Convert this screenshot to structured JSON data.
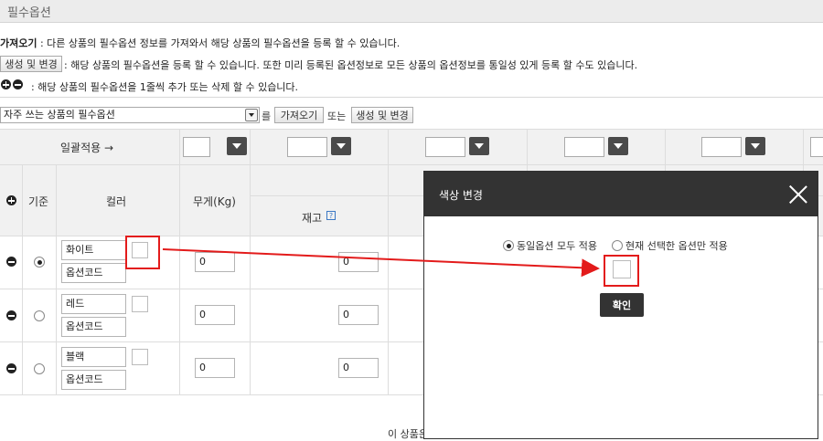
{
  "page": {
    "title": "필수옵션"
  },
  "intro": {
    "import_label": "가져오기",
    "import_desc": " : 다른 상품의 필수옵션 정보를 가져와서 해당 상품의 필수옵션을 등록 할 수 있습니다.",
    "generate_button": "생성 및 변경",
    "generate_desc": " : 해당 상품의 필수옵션을 등록 할 수 있습니다. 또한 미리 등록된 옵션정보로 모든 상품의 옵션정보를 통일성 있게 등록 할 수도 있습니다.",
    "addremove_desc": ": 해당 상품의 필수옵션을 1줄씩 추가 또는 삭제 할 수 있습니다."
  },
  "toolbar": {
    "preset_select": "자주 쓰는 상품의 필수옵션",
    "particle": "를",
    "import_button": "가져오기",
    "or": "또는",
    "generate_button": "생성 및 변경"
  },
  "table": {
    "bulk_apply": "일괄적용 →",
    "col_default": "기준",
    "col_color": "컬러",
    "col_weight": "무게(Kg)",
    "col_stock": "재고",
    "option_code_placeholder": "옵션코드",
    "rows": [
      {
        "color": "화이트",
        "code": "옵션코드",
        "weight": "0",
        "stock": "0",
        "selected": true
      },
      {
        "color": "레드",
        "code": "옵션코드",
        "weight": "0",
        "stock": "0",
        "selected": false
      },
      {
        "color": "블랙",
        "code": "옵션코드",
        "weight": "0",
        "stock": "0",
        "selected": false
      }
    ],
    "footer_fragment": "이 상품은"
  },
  "modal": {
    "title": "색상 변경",
    "option_all": "동일옵션 모두 적용",
    "option_current": "현재 선택한 옵션만 적용",
    "confirm": "확인"
  },
  "colors": {
    "annotation": "#e31b1b",
    "modal_header": "#333333"
  }
}
